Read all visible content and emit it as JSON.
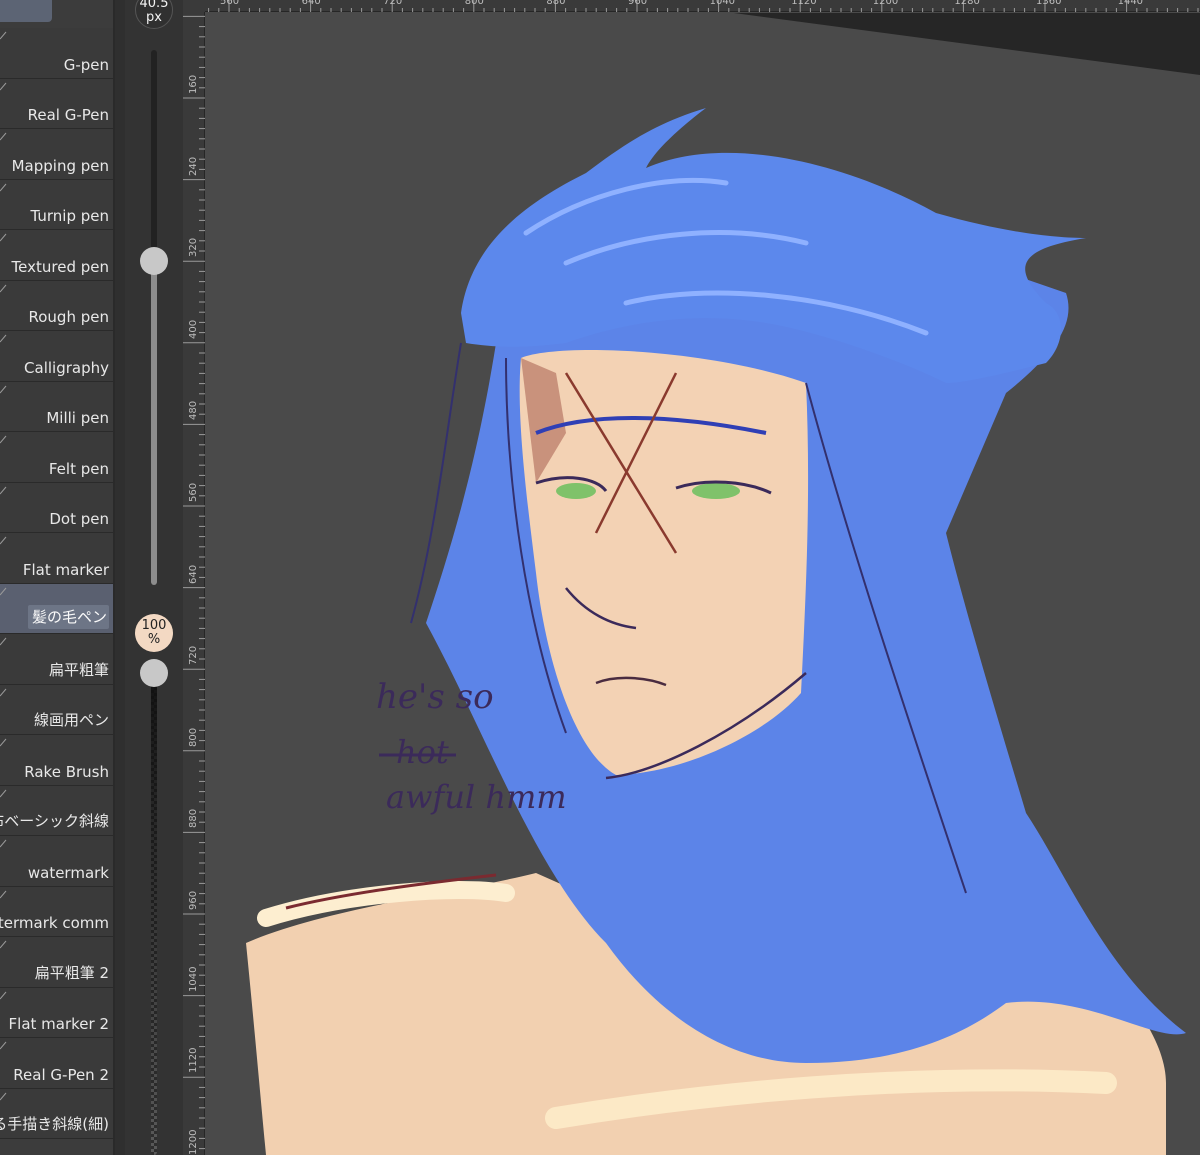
{
  "brushes": [
    {
      "label": "G-pen"
    },
    {
      "label": "Real G-Pen"
    },
    {
      "label": "Mapping pen"
    },
    {
      "label": "Turnip pen"
    },
    {
      "label": "Textured pen"
    },
    {
      "label": "Rough pen"
    },
    {
      "label": "Calligraphy"
    },
    {
      "label": "Milli pen"
    },
    {
      "label": "Felt pen"
    },
    {
      "label": "Dot pen"
    },
    {
      "label": "Flat marker"
    },
    {
      "label": "髪の毛ペン",
      "selected": true
    },
    {
      "label": "扁平粗筆"
    },
    {
      "label": "線画用ペン"
    },
    {
      "label": "Rake Brush"
    },
    {
      "label": "布ベーシック斜線"
    },
    {
      "label": "watermark"
    },
    {
      "label": "watermark comm"
    },
    {
      "label": "扁平粗筆 2"
    },
    {
      "label": "Flat marker 2"
    },
    {
      "label": "Real G-Pen 2"
    },
    {
      "label": "る手描き斜線(細)"
    }
  ],
  "brush_size": {
    "value": "40.5",
    "unit": "px",
    "level": 0.63
  },
  "brush_opacity": {
    "value": "100",
    "unit": "%",
    "level": 1.0
  },
  "ruler_top": [
    "560",
    "640",
    "720",
    "800",
    "880",
    "960",
    "1040",
    "1120",
    "1200",
    "1280",
    "1360",
    "1440"
  ],
  "ruler_left": [
    "160",
    "240",
    "320",
    "400",
    "480",
    "560",
    "640",
    "720",
    "800",
    "880",
    "960",
    "1040",
    "1120",
    "1200"
  ],
  "canvas_note": {
    "line1": "he's so",
    "line2_struck": "hot",
    "line3": "awful hmm"
  },
  "colors": {
    "panel_bg": "#3a3a3a",
    "selected_item": "#5a6070",
    "canvas_bg": "#4a4a4a",
    "hair_blue": "#5b86e6",
    "skin": "#f3d2b4",
    "line_purple": "#3b2a5a"
  }
}
